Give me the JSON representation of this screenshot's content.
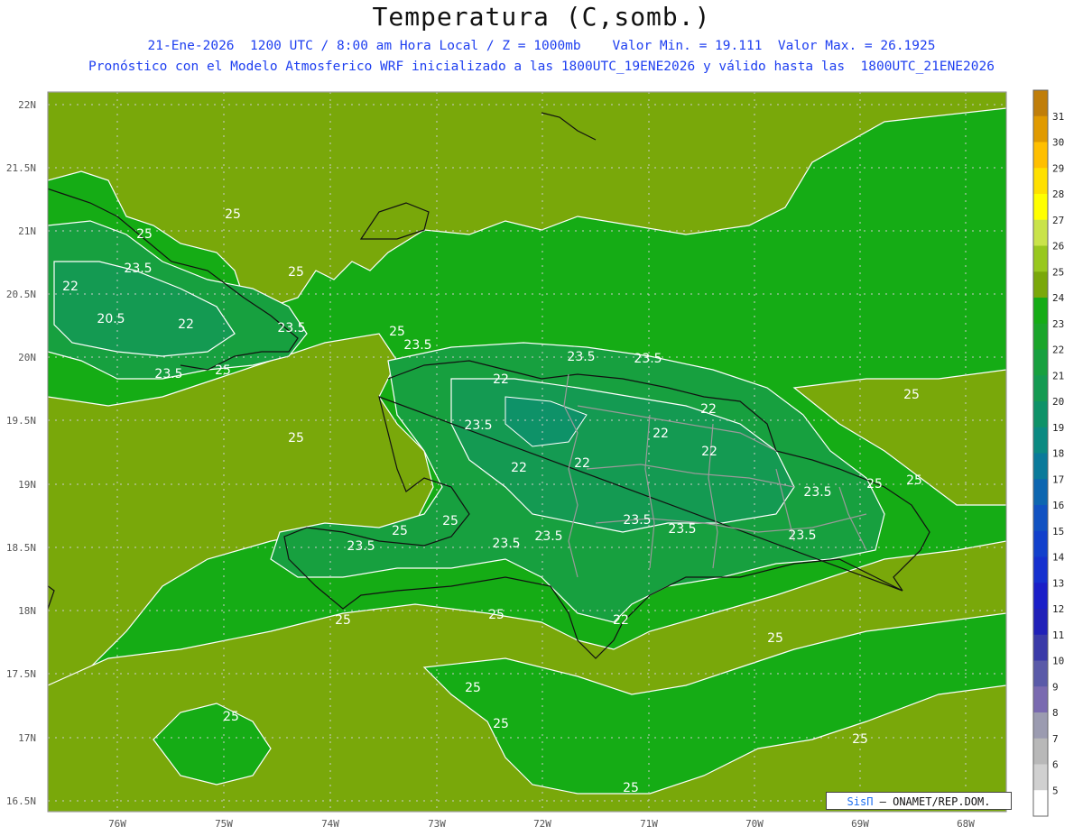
{
  "header": {
    "title": "Temperatura (C,somb.)",
    "line1": "21-Ene-2026  1200 UTC / 8:00 am Hora Local / Z = 1000mb    Valor Min. = 19.111  Valor Max. = 26.1925",
    "line2": "Pronóstico con el Modelo Atmosferico WRF inicializado a las 1800UTC_19ENE2026 y válido hasta las  1800UTC_21ENE2026"
  },
  "axes": {
    "lat_labels": [
      "22N",
      "21.5N",
      "21N",
      "20.5N",
      "20N",
      "19.5N",
      "19N",
      "18.5N",
      "18N",
      "17.5N",
      "17N",
      "16.5N"
    ],
    "lon_labels": [
      "76W",
      "75W",
      "74W",
      "73W",
      "72W",
      "71W",
      "70W",
      "69W",
      "68W"
    ]
  },
  "colorbar": {
    "ticks": [
      "31",
      "30",
      "29",
      "28",
      "27",
      "26",
      "25",
      "24",
      "23",
      "22",
      "21",
      "20",
      "19",
      "18",
      "17",
      "16",
      "15",
      "14",
      "13",
      "12",
      "11",
      "10",
      "9",
      "8",
      "7",
      "6",
      "5"
    ],
    "colors": [
      "#c07e0a",
      "#e09a00",
      "#ffbf00",
      "#ffe000",
      "#ffff00",
      "#c9e34a",
      "#98c81e",
      "#7aa80a",
      "#15ac15",
      "#1aa52a",
      "#17a03f",
      "#149a52",
      "#0e9268",
      "#0b8a82",
      "#0a7a9a",
      "#0d66b0",
      "#1152c2",
      "#1240cc",
      "#1530cf",
      "#1a1ec8",
      "#2020b8",
      "#3a3aa8",
      "#5a5aa8",
      "#7a6ab0",
      "#9b9bb0",
      "#b8b8b8",
      "#d0d0d0",
      "#ffffff"
    ]
  },
  "contour_labels": [
    "25",
    "25",
    "25",
    "25",
    "25",
    "25",
    "25",
    "25",
    "25",
    "25",
    "25",
    "25",
    "25",
    "25",
    "25",
    "25",
    "25",
    "25",
    "25",
    "23.5",
    "23.5",
    "23.5",
    "23.5",
    "23.5",
    "23.5",
    "23.5",
    "23.5",
    "23.5",
    "23.5",
    "23.5",
    "23.5",
    "23.5",
    "23.5",
    "22",
    "22",
    "22",
    "22",
    "22",
    "22",
    "22",
    "22",
    "22",
    "20.5"
  ],
  "credit": {
    "brand": "SisΠ",
    "text": "– ONAMET/REP.DOM."
  }
}
